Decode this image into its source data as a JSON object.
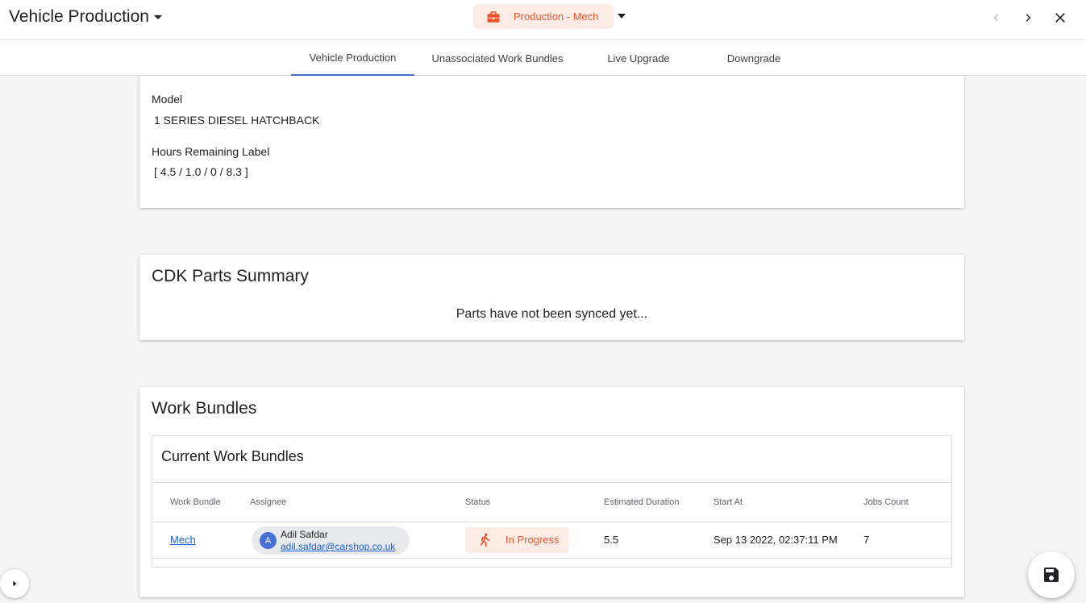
{
  "header": {
    "title": "Vehicle Production",
    "mode_label": "Production - Mech"
  },
  "tabs": [
    {
      "label": "Vehicle Production",
      "active": true
    },
    {
      "label": "Unassociated Work Bundles",
      "active": false
    },
    {
      "label": "Live Upgrade",
      "active": false
    },
    {
      "label": "Downgrade",
      "active": false
    }
  ],
  "details": {
    "model_label": "Model",
    "model_value": "1 SERIES DIESEL HATCHBACK",
    "hours_label": "Hours Remaining Label",
    "hours_value": "[ 4.5 / 1.0 / 0 / 8.3 ]"
  },
  "parts": {
    "title": "CDK Parts Summary",
    "empty_message": "Parts have not been synced yet..."
  },
  "work_bundles": {
    "title": "Work Bundles",
    "current_title": "Current Work Bundles",
    "columns": [
      "Work Bundle",
      "Assignee",
      "Status",
      "Estimated Duration",
      "Start At",
      "Jobs Count"
    ],
    "rows": [
      {
        "bundle": "Mech",
        "assignee_initial": "A",
        "assignee_name": "Adil Safdar",
        "assignee_email": "adil.safdar@carshop.co.uk",
        "status": "In Progress",
        "duration": "5.5",
        "start_at": "Sep 13 2022, 02:37:11 PM",
        "jobs_count": "7"
      }
    ]
  },
  "colors": {
    "accent": "#e8552e",
    "accent_bg": "#fdece6",
    "primary": "#4a6fd4",
    "link": "#1a5fd0"
  },
  "icons": {
    "mode": "briefcase-icon",
    "status": "running-person-icon",
    "save": "save-icon",
    "prev": "chevron-left-icon",
    "next": "chevron-right-icon",
    "close": "close-icon",
    "sidebar": "chevron-right-small-icon"
  }
}
